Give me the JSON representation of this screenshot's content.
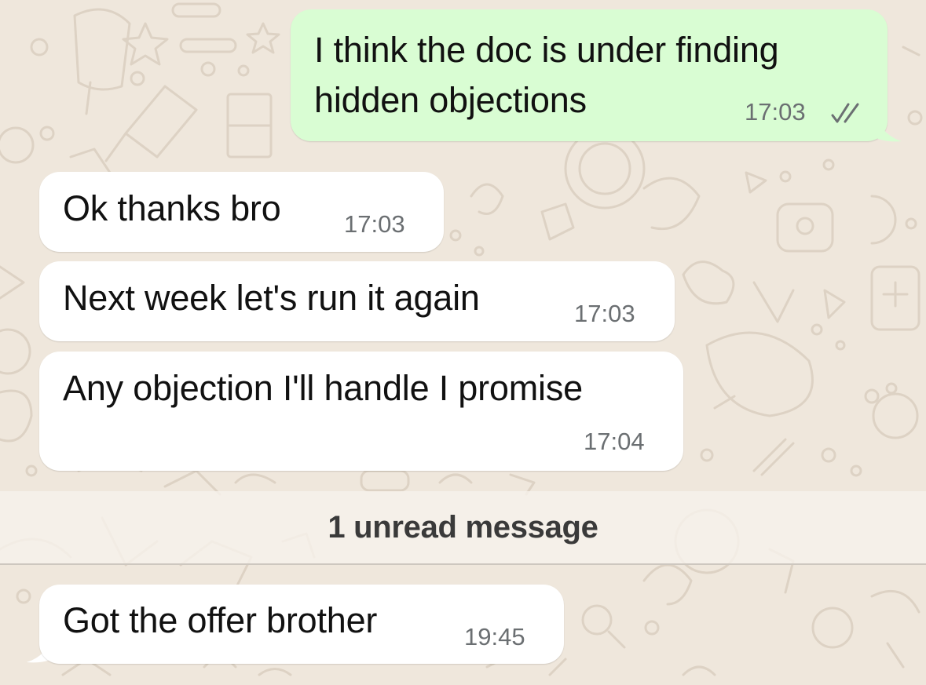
{
  "chat": {
    "messages": [
      {
        "direction": "outgoing",
        "text_line1": "I think the doc is under finding",
        "text_line2": "hidden objections",
        "time": "17:03",
        "status": "read",
        "status_icon": "double-check-icon"
      },
      {
        "direction": "incoming",
        "text": "Ok thanks bro",
        "time": "17:03"
      },
      {
        "direction": "incoming",
        "text": "Next week let's run it again",
        "time": "17:03"
      },
      {
        "direction": "incoming",
        "text": "Any objection I'll handle I promise",
        "time": "17:04"
      },
      {
        "direction": "incoming",
        "text": "Got the offer brother",
        "time": "19:45"
      }
    ],
    "unread_divider": "1 unread message"
  },
  "colors": {
    "wallpaper": "#efe7dc",
    "outgoing_bubble": "#d9fdd3",
    "incoming_bubble": "#ffffff",
    "timestamp": "#6b6f72",
    "read_ticks": "#6b6f72"
  }
}
